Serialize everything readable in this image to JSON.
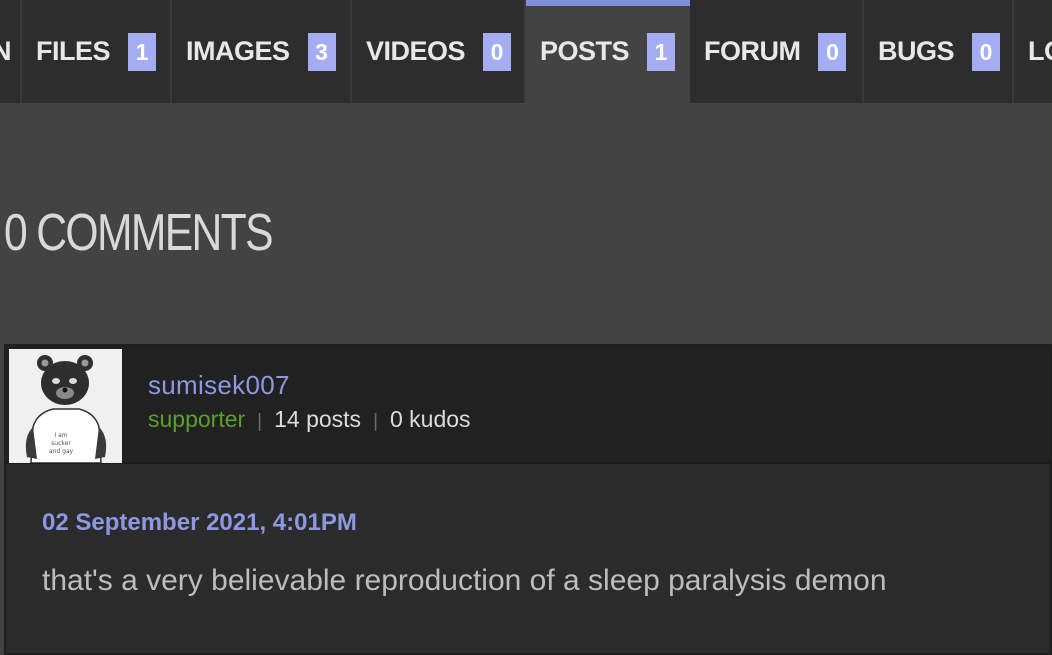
{
  "tabs": [
    {
      "label": "N",
      "count": ""
    },
    {
      "label": "FILES",
      "count": "1"
    },
    {
      "label": "IMAGES",
      "count": "3"
    },
    {
      "label": "VIDEOS",
      "count": "0"
    },
    {
      "label": "POSTS",
      "count": "1"
    },
    {
      "label": "FORUM",
      "count": "0"
    },
    {
      "label": "BUGS",
      "count": "0"
    },
    {
      "label": "LO",
      "count": ""
    }
  ],
  "section_title": "0 COMMENTS",
  "comment": {
    "username": "sumisek007",
    "role": "supporter",
    "posts": "14 posts",
    "kudos": "0 kudos",
    "separator": "|",
    "date": "02 September 2021, 4:01PM",
    "text": "that's a very believable reproduction of a sleep paralysis demon",
    "avatar_shirt_text": [
      "I am",
      "sucker",
      "and gay"
    ]
  },
  "colors": {
    "accent": "#8d98e2",
    "count_badge": "#a4acf2",
    "role": "#5aa02c",
    "active_tab_bar": "#7f8fd8"
  }
}
